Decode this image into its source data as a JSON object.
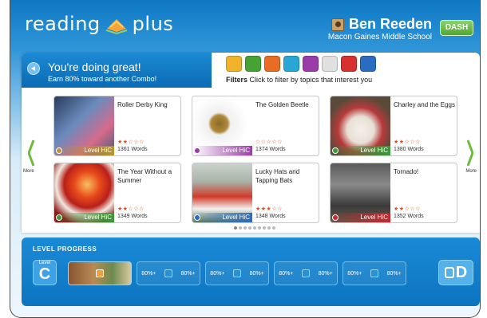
{
  "header": {
    "logo_left": "reading",
    "logo_right": "plus",
    "user_name": "Ben Reeden",
    "school": "Macon Gaines Middle School",
    "dash_label": "DASH"
  },
  "banner": {
    "title": "You're doing great!",
    "subtitle": "Earn 80% toward another Combo!"
  },
  "filters": {
    "label": "Filters",
    "hint": "Click to filter by topics that interest you",
    "icons": [
      "people-icon",
      "globe-icon",
      "fire-icon",
      "magnify-icon",
      "drum-icon",
      "tools-icon",
      "gear-flower-icon",
      "sports-ball-icon"
    ]
  },
  "cards": [
    {
      "title": "Roller Derby King",
      "level": "Level HiC",
      "stars": "★★☆☆☆",
      "words": "1361 Words",
      "color": "#b8952f"
    },
    {
      "title": "The Golden Beetle",
      "level": "Level HiC",
      "stars": "☆☆☆☆☆",
      "words": "1374 Words",
      "color": "#9b3da8"
    },
    {
      "title": "Charley and the Eggs",
      "level": "Level HiC",
      "stars": "★★☆☆☆",
      "words": "1380 Words",
      "color": "#3a9a3a"
    },
    {
      "title": "The Year Without a Summer",
      "level": "Level HiC",
      "stars": "★★☆☆☆",
      "words": "1349 Words",
      "color": "#3a9a3a"
    },
    {
      "title": "Lucky Hats and Tapping Bats",
      "level": "Level HiC",
      "stars": "★★★☆☆",
      "words": "1348 Words",
      "color": "#2a6cc0"
    },
    {
      "title": "Tornado!",
      "level": "Level HiC",
      "stars": "★★☆☆☆",
      "words": "1352 Words",
      "color": "#c2282e"
    }
  ],
  "nav": {
    "more_left": "More",
    "more_right": "More"
  },
  "progress": {
    "title": "LEVEL PROGRESS",
    "current_label": "Level",
    "current_letter": "C",
    "next_letter": "D",
    "stage_text": "80%+"
  }
}
